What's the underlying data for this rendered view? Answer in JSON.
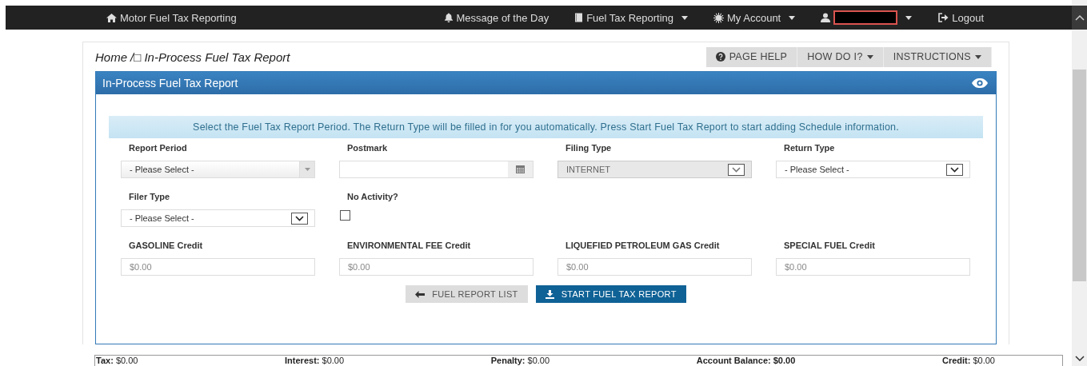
{
  "navbar": {
    "brand": "Motor Fuel Tax Reporting",
    "items": [
      {
        "label": "Message of the Day",
        "dropdown": false
      },
      {
        "label": "Fuel Tax Reporting",
        "dropdown": true
      },
      {
        "label": "My Account",
        "dropdown": true
      },
      {
        "redacted": true,
        "dropdown": true
      },
      {
        "label": "Logout",
        "dropdown": false
      }
    ]
  },
  "breadcrumb": {
    "home": "Home",
    "current": "/□ In-Process Fuel Tax Report"
  },
  "help_buttons": [
    {
      "label": "PAGE HELP",
      "dropdown": false
    },
    {
      "label": "HOW DO I?",
      "dropdown": true
    },
    {
      "label": "INSTRUCTIONS",
      "dropdown": true
    }
  ],
  "panel": {
    "title": "In-Process Fuel Tax Report",
    "info": "Select the Fuel Tax Report Period. The Return Type will be filled in for you automatically. Press Start Fuel Tax Report to start adding Schedule information.",
    "field_rows": [
      [
        {
          "label": "Report Period",
          "kind": "combo",
          "value": "- Please Select -",
          "disabled": false
        },
        {
          "label": "Postmark",
          "kind": "date",
          "disabled": false
        },
        {
          "label": "Filing Type",
          "kind": "select",
          "value": "INTERNET",
          "disabled": true
        },
        {
          "label": "Return Type",
          "kind": "select",
          "value": "- Please Select -",
          "disabled": false
        }
      ],
      [
        {
          "label": "Filer Type",
          "kind": "select",
          "value": "- Please Select -",
          "disabled": false
        },
        {
          "label": "No Activity?",
          "kind": "checkbox",
          "checked": false
        }
      ],
      [
        {
          "label": "GASOLINE Credit",
          "kind": "money",
          "placeholder": "$0.00"
        },
        {
          "label": "ENVIRONMENTAL FEE Credit",
          "kind": "money",
          "placeholder": "$0.00"
        },
        {
          "label": "LIQUEFIED PETROLEUM GAS Credit",
          "kind": "money",
          "placeholder": "$0.00"
        },
        {
          "label": "SPECIAL FUEL Credit",
          "kind": "money",
          "placeholder": "$0.00"
        }
      ]
    ],
    "buttons": [
      {
        "label": "FUEL REPORT LIST",
        "kind": "secondary"
      },
      {
        "label": "START FUEL TAX REPORT",
        "kind": "primary"
      }
    ]
  },
  "summary": [
    {
      "label": "Tax:",
      "value": "$0.00",
      "emphasized": false
    },
    {
      "label": "Interest:",
      "value": "$0.00",
      "emphasized": false
    },
    {
      "label": "Penalty:",
      "value": "$0.00",
      "emphasized": false
    },
    {
      "label": "Account Balance:",
      "value": "$0.00",
      "emphasized": true
    },
    {
      "label": "Credit:",
      "value": "$0.00",
      "emphasized": false
    }
  ]
}
